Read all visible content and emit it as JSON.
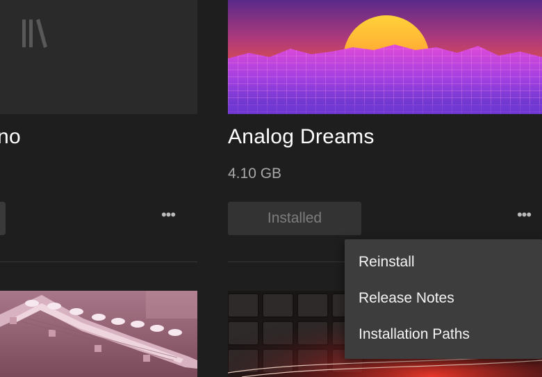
{
  "cards": [
    {
      "title": "no",
      "thumbnail_icon": "library-icon",
      "more_label": "•••"
    },
    {
      "title": "Analog Dreams",
      "size": "4.10 GB",
      "button_label": "Installed",
      "more_label": "•••"
    }
  ],
  "context_menu": {
    "items": [
      {
        "label": "Reinstall"
      },
      {
        "label": "Release Notes"
      },
      {
        "label": "Installation Paths"
      }
    ]
  },
  "colors": {
    "background": "#1e1e1e",
    "menu_background": "#3d3d3d",
    "button_background": "#333333",
    "button_text": "#7d7d7d",
    "secondary_text": "#a8a8a8"
  }
}
